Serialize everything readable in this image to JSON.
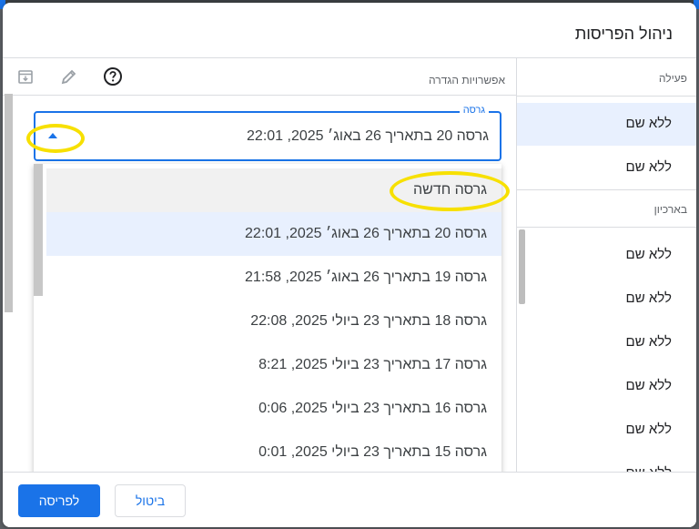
{
  "dialog": {
    "title": "ניהול הפריסות"
  },
  "right_pane": {
    "active_label": "פעילה",
    "active_items": [
      "ללא שם",
      "ללא שם"
    ],
    "archived_label": "בארכיון",
    "archived_items": [
      "ללא שם",
      "ללא שם",
      "ללא שם",
      "ללא שם",
      "ללא שם",
      "ללא שם"
    ]
  },
  "left_pane": {
    "toolbar_label": "אפשרויות הגדרה",
    "icons": [
      "help-icon",
      "edit-icon",
      "archive-icon"
    ],
    "version_select": {
      "label": "גרסה",
      "value": "גרסה 20 בתאריך 26 באוג׳ 2025, 22:01"
    },
    "dropdown_options": [
      "גרסה חדשה",
      "גרסה 20 בתאריך 26 באוג׳ 2025, 22:01",
      "גרסה 19 בתאריך 26 באוג׳ 2025, 21:58",
      "גרסה 18 בתאריך 23 ביולי 2025, 22:08",
      "גרסה 17 בתאריך 23 ביולי 2025, 8:21",
      "גרסה 16 בתאריך 23 ביולי 2025, 0:06",
      "גרסה 15 בתאריך 23 ביולי 2025, 0:01"
    ]
  },
  "footer": {
    "primary_label": "לפריסה",
    "cancel_label": "ביטול"
  },
  "colors": {
    "accent": "#1a73e8",
    "highlight": "#f7e000",
    "selected_bg": "#e8f0fe"
  }
}
